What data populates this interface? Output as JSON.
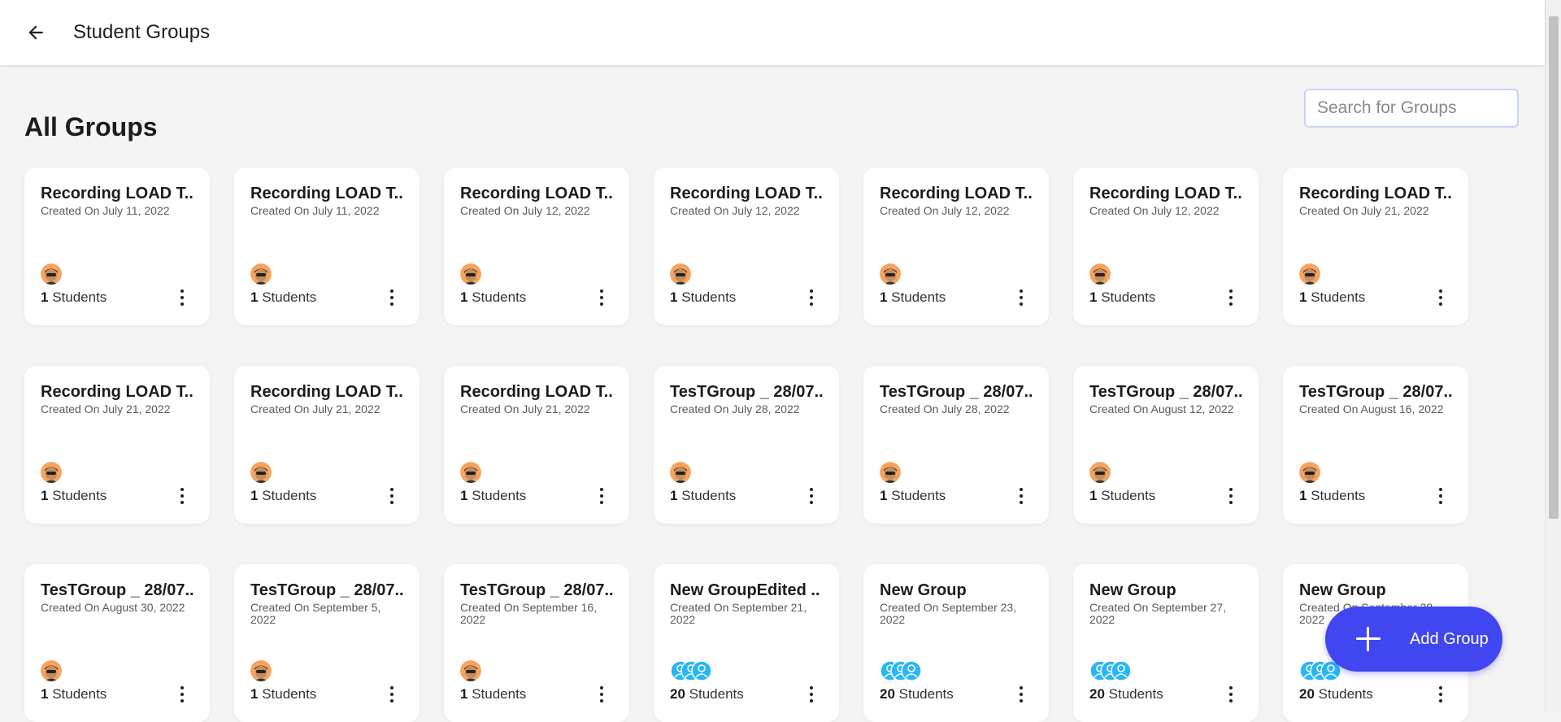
{
  "header": {
    "title": "Student Groups",
    "back_icon": "arrow-left-icon"
  },
  "main": {
    "title": "All Groups",
    "search_placeholder": "Search for Groups"
  },
  "groups": [
    {
      "title": "Recording LOAD T..",
      "date": "Created On July 11, 2022",
      "count": "1",
      "count_label": " Students",
      "avatar": "person"
    },
    {
      "title": "Recording LOAD T..",
      "date": "Created On July 11, 2022",
      "count": "1",
      "count_label": " Students",
      "avatar": "person"
    },
    {
      "title": "Recording LOAD T..",
      "date": "Created On July 12, 2022",
      "count": "1",
      "count_label": " Students",
      "avatar": "person"
    },
    {
      "title": "Recording LOAD T..",
      "date": "Created On July 12, 2022",
      "count": "1",
      "count_label": " Students",
      "avatar": "person"
    },
    {
      "title": "Recording LOAD T..",
      "date": "Created On July 12, 2022",
      "count": "1",
      "count_label": " Students",
      "avatar": "person"
    },
    {
      "title": "Recording LOAD T..",
      "date": "Created On July 12, 2022",
      "count": "1",
      "count_label": " Students",
      "avatar": "person"
    },
    {
      "title": "Recording LOAD T..",
      "date": "Created On July 21, 2022",
      "count": "1",
      "count_label": " Students",
      "avatar": "person"
    },
    {
      "title": "Recording LOAD T..",
      "date": "Created On July 21, 2022",
      "count": "1",
      "count_label": " Students",
      "avatar": "person"
    },
    {
      "title": "Recording LOAD T..",
      "date": "Created On July 21, 2022",
      "count": "1",
      "count_label": " Students",
      "avatar": "person"
    },
    {
      "title": "Recording LOAD T..",
      "date": "Created On July 21, 2022",
      "count": "1",
      "count_label": " Students",
      "avatar": "person"
    },
    {
      "title": "TesTGroup _ 28/07..",
      "date": "Created On July 28, 2022",
      "count": "1",
      "count_label": " Students",
      "avatar": "person"
    },
    {
      "title": "TesTGroup _ 28/07..",
      "date": "Created On July 28, 2022",
      "count": "1",
      "count_label": " Students",
      "avatar": "person"
    },
    {
      "title": "TesTGroup _ 28/07..",
      "date": "Created On August 12, 2022",
      "count": "1",
      "count_label": " Students",
      "avatar": "person"
    },
    {
      "title": "TesTGroup _ 28/07..",
      "date": "Created On August 16, 2022",
      "count": "1",
      "count_label": " Students",
      "avatar": "person"
    },
    {
      "title": "TesTGroup _ 28/07..",
      "date": "Created On August 30, 2022",
      "count": "1",
      "count_label": " Students",
      "avatar": "person"
    },
    {
      "title": "TesTGroup _ 28/07..",
      "date": "Created On September 5, 2022",
      "count": "1",
      "count_label": " Students",
      "avatar": "person"
    },
    {
      "title": "TesTGroup _ 28/07..",
      "date": "Created On September 16, 2022",
      "count": "1",
      "count_label": " Students",
      "avatar": "person"
    },
    {
      "title": "New GroupEdited ..",
      "date": "Created On September 21, 2022",
      "count": "20",
      "count_label": " Students",
      "avatar": "group"
    },
    {
      "title": "New Group",
      "date": "Created On September 23, 2022",
      "count": "20",
      "count_label": " Students",
      "avatar": "group"
    },
    {
      "title": "New Group",
      "date": "Created On September 27, 2022",
      "count": "20",
      "count_label": " Students",
      "avatar": "group"
    },
    {
      "title": "New Group",
      "date": "Created On September 28, 2022",
      "count": "20",
      "count_label": " Students",
      "avatar": "group"
    }
  ],
  "add_button": {
    "label": "Add Group",
    "icon": "plus-icon"
  },
  "colors": {
    "accent": "#4046f0",
    "background": "#f4f4f4",
    "avatar_person": "#f4a460",
    "avatar_group": "#29b6f6"
  }
}
